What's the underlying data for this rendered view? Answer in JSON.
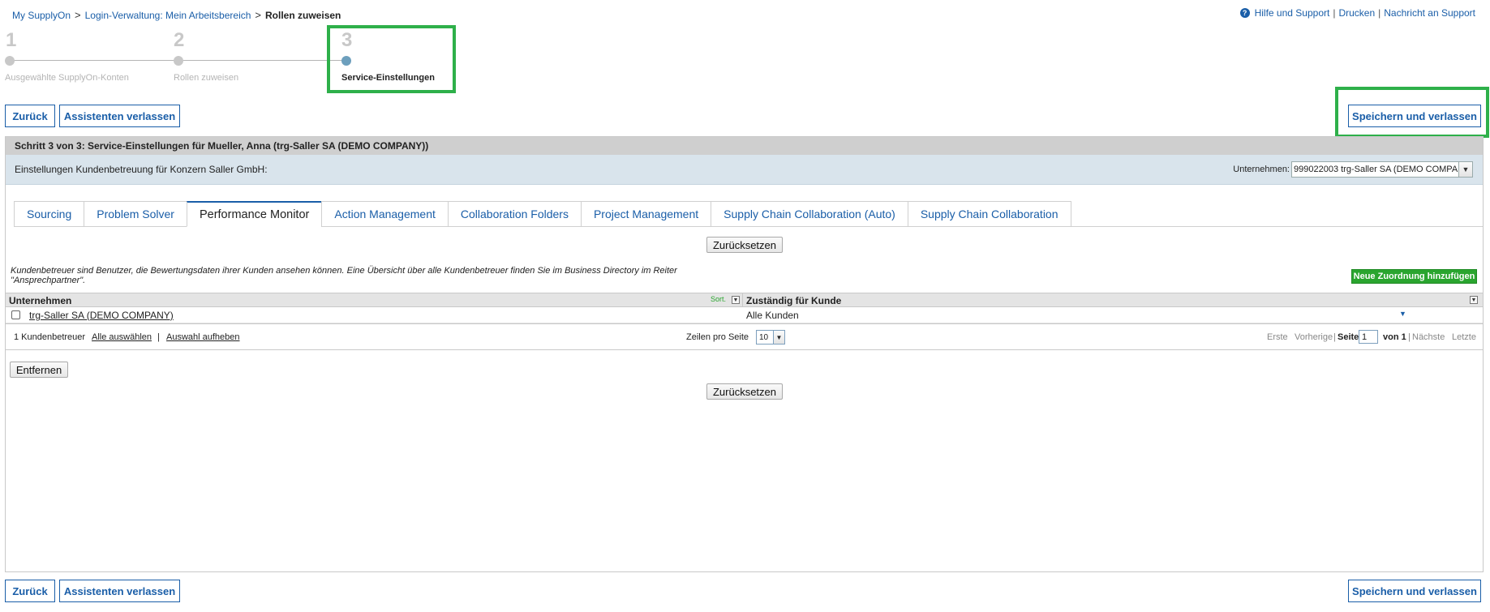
{
  "breadcrumb": {
    "items": [
      "My SupplyOn",
      "Login-Verwaltung: Mein Arbeitsbereich"
    ],
    "current": "Rollen zuweisen",
    "separator": ">"
  },
  "help": {
    "icon": "question-circle-icon",
    "links": [
      "Hilfe und Support",
      "Drucken",
      "Nachricht an Support"
    ],
    "divider": "|"
  },
  "wizard": {
    "steps": [
      {
        "number": "1",
        "label": "Ausgewählte SupplyOn-Konten"
      },
      {
        "number": "2",
        "label": "Rollen zuweisen"
      },
      {
        "number": "3",
        "label": "Service-Einstellungen",
        "active": true
      }
    ]
  },
  "actions": {
    "back": "Zurück",
    "leave": "Assistenten verlassen",
    "save_leave": "Speichern und verlassen"
  },
  "panel": {
    "title": "Schritt 3 von 3: Service-Einstellungen für Mueller, Anna (trg-Saller SA (DEMO COMPANY))",
    "subtitle": "Einstellungen Kundenbetreuung für Konzern Saller GmbH:",
    "company_label": "Unternehmen:",
    "company_value": "999022003 trg-Saller SA (DEMO COMPANY)"
  },
  "tabs": [
    "Sourcing",
    "Problem Solver",
    "Performance Monitor",
    "Action Management",
    "Collaboration Folders",
    "Project Management",
    "Supply Chain Collaboration (Auto)",
    "Supply Chain Collaboration"
  ],
  "active_tab": "Performance Monitor",
  "reset_label": "Zurücksetzen",
  "description": "Kundenbetreuer sind Benutzer, die Bewertungsdaten ihrer Kunden ansehen können. Eine Übersicht über alle Kundenbetreuer finden Sie im Business Directory im Reiter \"Ansprechpartner\".",
  "add_mapping": "Neue Zuordnung hinzufügen",
  "table": {
    "columns": [
      "Unternehmen",
      "Zuständig für Kunde"
    ],
    "sort_label": "Sort.",
    "rows": [
      {
        "company": "trg-Saller SA (DEMO COMPANY)",
        "customer": "Alle Kunden"
      }
    ]
  },
  "footer": {
    "count": "1 Kundenbetreuer",
    "select_all": "Alle auswählen",
    "deselect": "Auswahl aufheben",
    "divider": "|",
    "rows_per_page_label": "Zeilen pro Seite",
    "rows_per_page": "10",
    "first": "Erste",
    "prev": "Vorherige",
    "page_label": "Seite",
    "page": "1",
    "of": "von 1",
    "next": "Nächste",
    "last": "Letzte"
  },
  "remove_label": "Entfernen",
  "colors": {
    "link": "#1a5ea8",
    "highlight": "#2eb04a",
    "add_button": "#2aa52f",
    "panel_header": "#cfcfcf",
    "subheader": "#d9e4ec"
  }
}
